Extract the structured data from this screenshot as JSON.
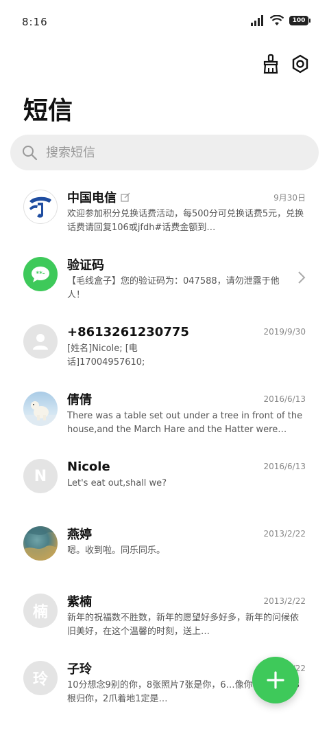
{
  "status": {
    "time": "8:16",
    "battery": "100"
  },
  "header": {
    "title": "短信"
  },
  "search": {
    "placeholder": "搜索短信"
  },
  "messages": [
    {
      "name": "中国电信",
      "date": "9月30日",
      "preview": "欢迎参加积分兑换话费活动，每500分可兑换话费5元，兑换话费请回复106或jfdh#话费金额到…",
      "avatar": "telecom-logo"
    },
    {
      "name": "验证码",
      "date": "",
      "preview": "【毛线盒子】您的验证码为：047588，请勿泄露于他人！",
      "avatar": "sms-icon"
    },
    {
      "name": "+8613261230775",
      "date": "2019/9/30",
      "preview": "[姓名]Nicole; [电话]17004957610;",
      "avatar": "person-icon"
    },
    {
      "name": "倩倩",
      "date": "2016/6/13",
      "preview": "There was a table set out under a tree in front of the house,and the March Hare and the Hatter were…",
      "avatar": "polar-bear-photo"
    },
    {
      "name": "Nicole",
      "date": "2016/6/13",
      "preview": "Let's eat out,shall we?",
      "avatar": "N"
    },
    {
      "name": "燕婷",
      "date": "2013/2/22",
      "preview": "嗯。收到啦。同乐同乐。",
      "avatar": "landscape-photo"
    },
    {
      "name": "紫楠",
      "date": "2013/2/22",
      "preview": "新年的祝福数不胜数，新年的愿望好多好多，新年的问候依旧美好，在这个温馨的时刻，送上…",
      "avatar": "楠"
    },
    {
      "name": "子玲",
      "date": "2013/2/22",
      "preview": "10分想念9别的你，8张照片7张是你，6…像你，4根骨头3根归你，2爪着地1定是…",
      "avatar": "玲"
    }
  ],
  "colors": {
    "accent": "#3ec95a",
    "telecom_blue": "#1f4da0"
  }
}
